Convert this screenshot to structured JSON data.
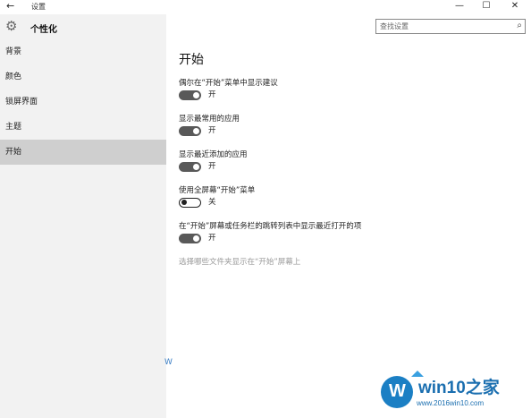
{
  "titlebar": {
    "back": "←",
    "title": "设置",
    "minimize": "—",
    "maximize": "☐",
    "close": "✕"
  },
  "sidebar": {
    "app_title": "个性化",
    "items": [
      {
        "label": "背景"
      },
      {
        "label": "颜色"
      },
      {
        "label": "锁屏界面"
      },
      {
        "label": "主题"
      },
      {
        "label": "开始"
      }
    ],
    "active_index": 4
  },
  "search": {
    "placeholder": "查找设置",
    "icon": "search-icon"
  },
  "main": {
    "title": "开始",
    "settings": [
      {
        "label": "偶尔在“开始”菜单中显示建议",
        "state": "开",
        "on": true
      },
      {
        "label": "显示最常用的应用",
        "state": "开",
        "on": true
      },
      {
        "label": "显示最近添加的应用",
        "state": "开",
        "on": true
      },
      {
        "label": "使用全屏幕“开始”菜单",
        "state": "关",
        "on": false
      },
      {
        "label": "在“开始”屏幕或任务栏的跳转列表中显示最近打开的项",
        "state": "开",
        "on": true
      }
    ],
    "link": "选择哪些文件夹显示在“开始”屏幕上"
  },
  "watermark": {
    "brand": "win10之家",
    "url": "www.2016win10.com",
    "logo_letter": "W",
    "fragment": "W"
  }
}
